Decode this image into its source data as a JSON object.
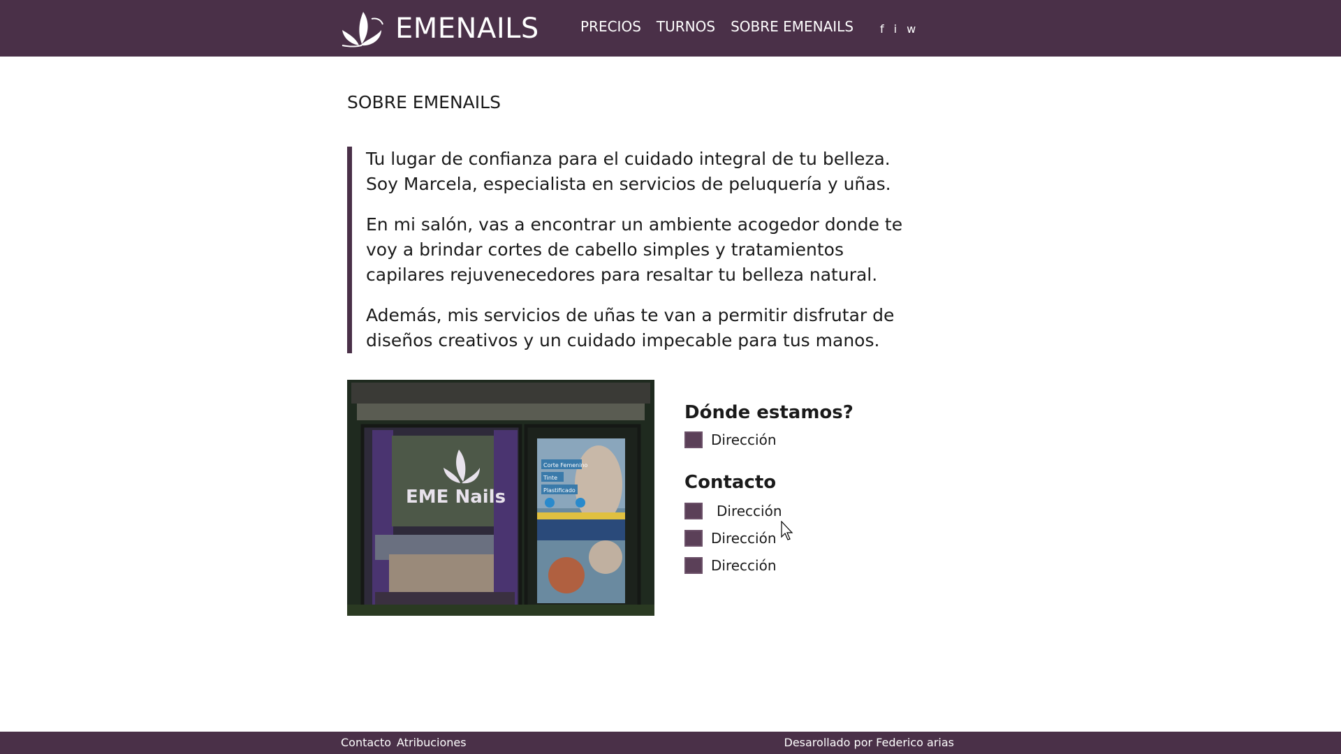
{
  "header": {
    "brand": "EMENAILS",
    "nav": [
      {
        "label": "PRECIOS"
      },
      {
        "label": "TURNOS"
      },
      {
        "label": "SOBRE EMENAILS"
      }
    ],
    "social": [
      {
        "label": "f",
        "icon": "facebook-icon"
      },
      {
        "label": "i",
        "icon": "instagram-icon"
      },
      {
        "label": "w",
        "icon": "whatsapp-icon"
      }
    ],
    "background": "#4a3048"
  },
  "main": {
    "title": "SOBRE EMENAILS",
    "paragraphs": [
      "Tu lugar de confianza para el cuidado integral de tu belleza. Soy Marcela, especialista en servicios de peluquería y uñas.",
      "En mi salón, vas a encontrar un ambiente acogedor donde te voy a brindar cortes de cabello simples y tratamientos capilares rejuvenecedores para resaltar tu belleza natural.",
      "Además, mis servicios de uñas te van a permitir disfrutar de diseños creativos y un cuidado impecable para tus manos."
    ],
    "storefront": {
      "sign": "EME Nails",
      "poster_lines": [
        "Corte Femenino",
        "Tinte",
        "Plastificado"
      ]
    },
    "location": {
      "title": "Dónde estamos?",
      "items": [
        {
          "label": "Dirección"
        }
      ]
    },
    "contact": {
      "title": "Contacto",
      "items": [
        {
          "label": "Dirección"
        },
        {
          "label": "Dirección"
        },
        {
          "label": "Dirección"
        }
      ]
    },
    "accent_color": "#5b4058"
  },
  "footer": {
    "contact": "Contacto",
    "attributions": "Atribuciones",
    "credit": "Desarollado por Federico arias"
  }
}
